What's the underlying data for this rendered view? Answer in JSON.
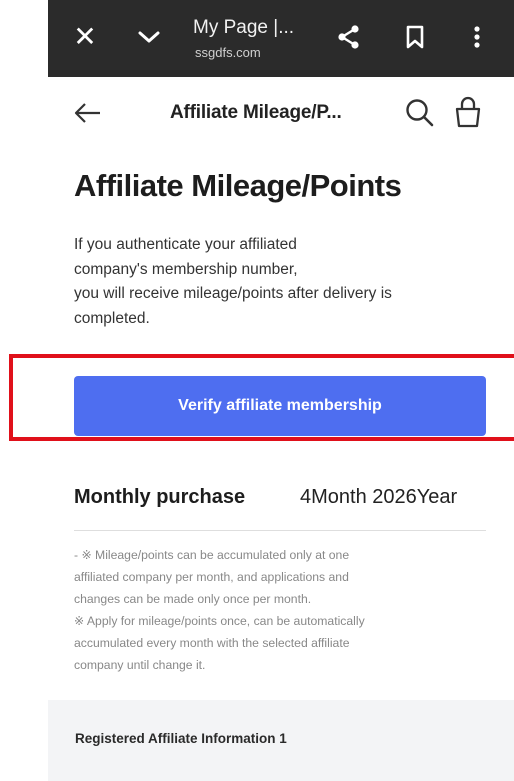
{
  "browser": {
    "page_title": "My Page |...",
    "url": "ssgdfs.com",
    "icons": [
      "close-icon",
      "chevron-down-icon",
      "share-icon",
      "bookmark-icon",
      "more-vertical-icon"
    ]
  },
  "header": {
    "title": "Affiliate Mileage/P...",
    "icons": [
      "back-arrow-icon",
      "search-icon",
      "shopping-bag-icon"
    ]
  },
  "main": {
    "title": "Affiliate Mileage/Points",
    "intro_lines": [
      "If you authenticate your affiliated",
      "company's membership number,",
      "you will receive mileage/points after delivery is",
      "completed."
    ],
    "verify_button_label": "Verify affiliate membership",
    "monthly_label": "Monthly purchase",
    "monthly_value": "4Month 2026Year",
    "notes_lines": [
      "- ※ Mileage/points can be accumulated only at one",
      "affiliated company per month, and applications and",
      "changes can be made only once per month.",
      "※ Apply for mileage/points once, can be automatically",
      "accumulated every month with the selected affiliate",
      "company until change it."
    ],
    "registered_title": "Registered Affiliate Information 1"
  },
  "colors": {
    "browser_bar": "#2b2b2b",
    "primary_button": "#4e6ef0",
    "highlight": "#e0101a",
    "section_bg": "#f3f4f6"
  }
}
